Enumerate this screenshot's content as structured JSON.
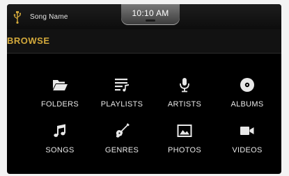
{
  "status_bar": {
    "song_name": "Song Name",
    "time": "10:10 AM",
    "source_icon": "usb-icon"
  },
  "header": {
    "title": "BROWSE"
  },
  "browse_items": [
    {
      "label": "FOLDERS",
      "icon": "folder-icon"
    },
    {
      "label": "PLAYLISTS",
      "icon": "playlist-icon"
    },
    {
      "label": "ARTISTS",
      "icon": "microphone-icon"
    },
    {
      "label": "ALBUMS",
      "icon": "disc-icon"
    },
    {
      "label": "SONGS",
      "icon": "music-note-icon"
    },
    {
      "label": "GENRES",
      "icon": "guitar-icon"
    },
    {
      "label": "PHOTOS",
      "icon": "photo-icon"
    },
    {
      "label": "VIDEOS",
      "icon": "video-camera-icon"
    }
  ],
  "colors": {
    "accent": "#d3a93b",
    "background": "#000000",
    "text": "#e8e8e8"
  }
}
